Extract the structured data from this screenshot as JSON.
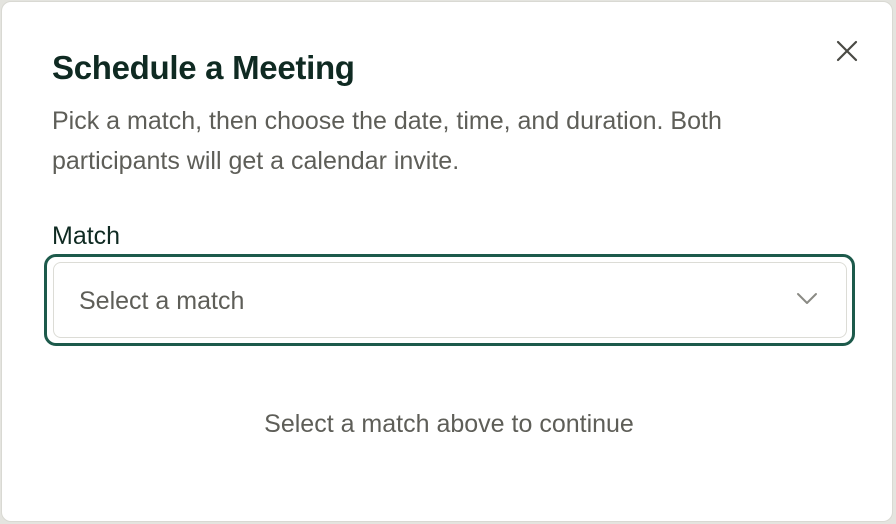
{
  "dialog": {
    "title": "Schedule a Meeting",
    "description": "Pick a match, then choose the date, time, and duration. Both participants will get a calendar invite.",
    "close_icon": "close-icon"
  },
  "match_field": {
    "label": "Match",
    "selected_value": "Select a match",
    "dropdown_icon": "chevron-down-icon",
    "focus_color": "#1d5a4b"
  },
  "hint": "Select a match above to continue",
  "colors": {
    "title": "#0f2a22",
    "body_text": "#5e5e58",
    "accent": "#1d5a4b"
  }
}
